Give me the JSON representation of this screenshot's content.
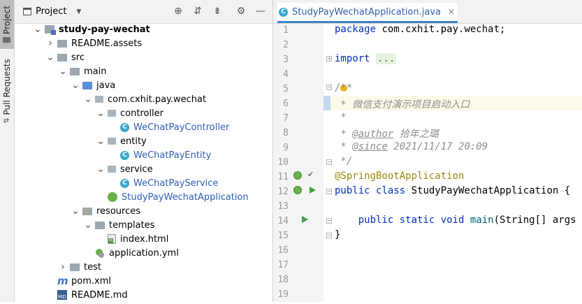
{
  "sidebar_strip": {
    "project_tab": "Project",
    "pull_requests_tab": "Pull Requests"
  },
  "project_panel": {
    "title": "Project",
    "tree": [
      {
        "label": "study-pay-wechat",
        "type": "module",
        "arrow": "down",
        "level": 0
      },
      {
        "label": "README.assets",
        "type": "folder",
        "arrow": "right",
        "level": 1
      },
      {
        "label": "src",
        "type": "folder",
        "arrow": "down",
        "level": 1
      },
      {
        "label": "main",
        "type": "folder",
        "arrow": "down",
        "level": 2
      },
      {
        "label": "java",
        "type": "folder-blue",
        "arrow": "down",
        "level": 3
      },
      {
        "label": "com.cxhit.pay.wechat",
        "type": "package",
        "arrow": "down",
        "level": 4
      },
      {
        "label": "controller",
        "type": "package",
        "arrow": "down",
        "level": 5
      },
      {
        "label": "WeChatPayController",
        "type": "class",
        "arrow": "",
        "level": 6
      },
      {
        "label": "entity",
        "type": "package",
        "arrow": "down",
        "level": 5
      },
      {
        "label": "WeChatPayEntity",
        "type": "class",
        "arrow": "",
        "level": 6
      },
      {
        "label": "service",
        "type": "package",
        "arrow": "down",
        "level": 5
      },
      {
        "label": "WeChatPayService",
        "type": "class",
        "arrow": "",
        "level": 6
      },
      {
        "label": "StudyPayWechatApplication",
        "type": "spring-class",
        "arrow": "",
        "level": 5
      },
      {
        "label": "resources",
        "type": "resources",
        "arrow": "down",
        "level": 3
      },
      {
        "label": "templates",
        "type": "folder",
        "arrow": "down",
        "level": 4
      },
      {
        "label": "index.html",
        "type": "html",
        "arrow": "",
        "level": 5
      },
      {
        "label": "application.yml",
        "type": "yml",
        "arrow": "",
        "level": 4
      },
      {
        "label": "test",
        "type": "folder",
        "arrow": "right",
        "level": 2
      },
      {
        "label": "pom.xml",
        "type": "maven",
        "arrow": "",
        "level": 1
      },
      {
        "label": "README.md",
        "type": "md",
        "arrow": "",
        "level": 1
      }
    ]
  },
  "editor": {
    "tab_label": "StudyPayWechatApplication.java",
    "line_numbers": [
      "1",
      "2",
      "3",
      "4",
      "5",
      "6",
      "7",
      "8",
      "9",
      "10",
      "11",
      "12",
      "13",
      "14",
      "15",
      "16",
      "17",
      "18",
      "19"
    ],
    "code": {
      "l1_kw": "package",
      "l1_rest": " com.cxhit.pay.wechat;",
      "l3_kw": "import",
      "l3_dots": "...",
      "l6": "/**",
      "l7": " * 微信支付演示项目启动入口",
      "l8": " *",
      "l9_star": " * ",
      "l9_tag": "@author",
      "l9_val": " 拾年之璐",
      "l10_star": " * ",
      "l10_tag": "@since",
      "l10_val": " 2021/11/17 20:09",
      "l11": " */",
      "l12": "@SpringBootApplication",
      "l13_kw": "public class",
      "l13_rest": " StudyPayWechatApplication {",
      "l15_kw": "    public static void",
      "l15_fn": " main",
      "l15_rest": "(String[] args",
      "l16": "}"
    }
  }
}
